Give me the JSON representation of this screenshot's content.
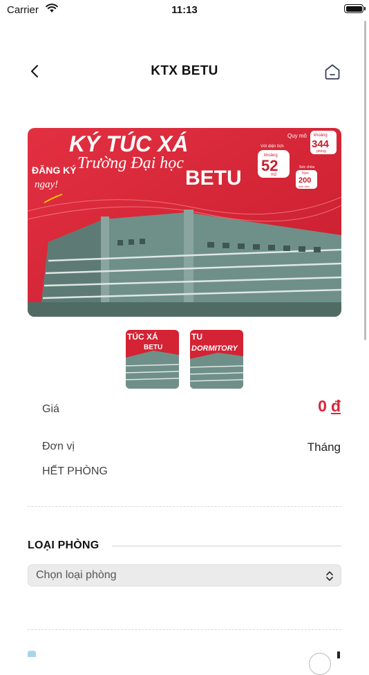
{
  "status_bar": {
    "carrier": "Carrier",
    "time": "11:13"
  },
  "header": {
    "title": "KTX BETU"
  },
  "banner": {
    "headline": "KÝ TÚC XÁ",
    "script_line": "Trường Đại học",
    "brand": "BETU",
    "register_1": "ĐĂNG KÝ",
    "register_2": "ngay!",
    "scale_label": "Quy mô",
    "rooms_prefix": "khoảng",
    "rooms_value": "344",
    "rooms_unit": "phòng",
    "area_label": "Với diện tích",
    "area_prefix": "khoảng",
    "area_value": "52",
    "area_unit": "m2",
    "students_label": "Sức chứa",
    "students_prefix": "Hơn",
    "students_value": "200",
    "students_unit": "sinh viên"
  },
  "thumbnails": [
    {
      "line1": "TÚC XÁ",
      "line2": "BETU"
    },
    {
      "line1": "TU",
      "line2": "DORMITORY"
    }
  ],
  "details": {
    "price_label": "Giá",
    "price_value": "0",
    "price_currency": "đ",
    "unit_label": "Đơn vị",
    "unit_value": "Tháng",
    "availability": "HẾT PHÒNG"
  },
  "room_type": {
    "section_title": "LOẠI PHÒNG",
    "select_value": "Chọn loại phòng"
  },
  "colors": {
    "accent": "#d8253a",
    "banner_red": "#d42334",
    "building": "#6f9089"
  }
}
